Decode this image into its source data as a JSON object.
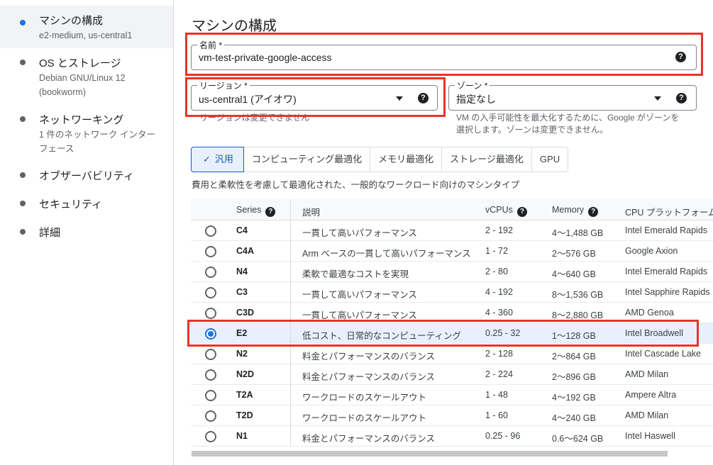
{
  "sidebar": {
    "items": [
      {
        "title": "マシンの構成",
        "sub": "e2-medium, us-central1",
        "active": true
      },
      {
        "title": "OS とストレージ",
        "sub": "Debian GNU/Linux 12 (bookworm)",
        "active": false
      },
      {
        "title": "ネットワーキング",
        "sub": "1 件のネットワーク インターフェース",
        "active": false
      },
      {
        "title": "オブザーバビリティ",
        "sub": "",
        "active": false
      },
      {
        "title": "セキュリティ",
        "sub": "",
        "active": false
      },
      {
        "title": "詳細",
        "sub": "",
        "active": false
      }
    ]
  },
  "main": {
    "title": "マシンの構成",
    "name_field": {
      "label": "名前 *",
      "value": "vm-test-private-google-access"
    },
    "region_field": {
      "label": "リージョン *",
      "value": "us-central1 (アイオワ)",
      "hint": "リージョンは変更できません"
    },
    "zone_field": {
      "label": "ゾーン *",
      "value": "指定なし",
      "hint": "VM の入手可能性を最大化するために、Google がゾーンを選択します。ゾーンは変更できません。"
    },
    "help_glyph": "?",
    "tabs": [
      {
        "label": "汎用",
        "selected": true
      },
      {
        "label": "コンピューティング最適化",
        "selected": false
      },
      {
        "label": "メモリ最適化",
        "selected": false
      },
      {
        "label": "ストレージ最適化",
        "selected": false
      },
      {
        "label": "GPU",
        "selected": false
      }
    ],
    "tab_description": "費用と柔軟性を考慮して最適化された、一般的なワークロード向けのマシンタイプ"
  },
  "table": {
    "headers": {
      "series": "Series",
      "description": "説明",
      "vcpus": "vCPUs",
      "memory": "Memory",
      "cpu_platform": "CPU プラットフォーム"
    },
    "rows": [
      {
        "series": "C4",
        "description": "一貫して高いパフォーマンス",
        "vcpus": "2 - 192",
        "memory": "4〜1,488 GB",
        "cpu": "Intel Emerald Rapids",
        "selected": false
      },
      {
        "series": "C4A",
        "description": "Arm ベースの一貫して高いパフォーマンス",
        "vcpus": "1 - 72",
        "memory": "2〜576 GB",
        "cpu": "Google Axion",
        "selected": false
      },
      {
        "series": "N4",
        "description": "柔軟で最適なコストを実現",
        "vcpus": "2 - 80",
        "memory": "4〜640 GB",
        "cpu": "Intel Emerald Rapids",
        "selected": false
      },
      {
        "series": "C3",
        "description": "一貫して高いパフォーマンス",
        "vcpus": "4 - 192",
        "memory": "8〜1,536 GB",
        "cpu": "Intel Sapphire Rapids",
        "selected": false
      },
      {
        "series": "C3D",
        "description": "一貫して高いパフォーマンス",
        "vcpus": "4 - 360",
        "memory": "8〜2,880 GB",
        "cpu": "AMD Genoa",
        "selected": false
      },
      {
        "series": "E2",
        "description": "低コスト、日常的なコンピューティング",
        "vcpus": "0.25 - 32",
        "memory": "1〜128 GB",
        "cpu": "Intel Broadwell",
        "selected": true
      },
      {
        "series": "N2",
        "description": "料金とパフォーマンスのバランス",
        "vcpus": "2 - 128",
        "memory": "2〜864 GB",
        "cpu": "Intel Cascade Lake",
        "selected": false
      },
      {
        "series": "N2D",
        "description": "料金とパフォーマンスのバランス",
        "vcpus": "2 - 224",
        "memory": "2〜896 GB",
        "cpu": "AMD Milan",
        "selected": false
      },
      {
        "series": "T2A",
        "description": "ワークロードのスケールアウト",
        "vcpus": "1 - 48",
        "memory": "4〜192 GB",
        "cpu": "Ampere Altra",
        "selected": false
      },
      {
        "series": "T2D",
        "description": "ワークロードのスケールアウト",
        "vcpus": "1 - 60",
        "memory": "4〜240 GB",
        "cpu": "AMD Milan",
        "selected": false
      },
      {
        "series": "N1",
        "description": "料金とパフォーマンスのバランス",
        "vcpus": "0.25 - 96",
        "memory": "0.6〜624 GB",
        "cpu": "Intel Haswell",
        "selected": false
      }
    ]
  },
  "colors": {
    "accent": "#1a73e8",
    "highlight": "#e8332a",
    "selected_row": "#e8f0fe"
  }
}
